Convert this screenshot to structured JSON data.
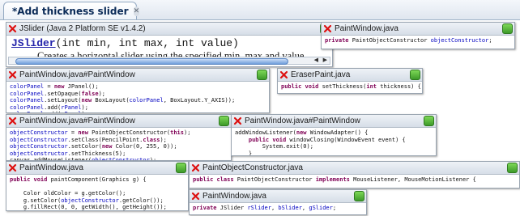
{
  "tab": {
    "label": "*Add thickness slider",
    "close": "✕"
  },
  "doc": {
    "title": "JSlider (Java 2 Platform SE v1.4.2)",
    "sig_link": "JSlider",
    "sig_rest": "(int min, int max, int value)",
    "description": "Creates a horizontal slider using the specified min, max and value."
  },
  "bubbles": [
    {
      "id": "b1",
      "title": "PaintWindow.java",
      "lines": [
        [
          [
            "kw",
            "private "
          ],
          [
            "t",
            "PaintObjectConstructor "
          ],
          [
            "fld",
            "objectConstructor"
          ],
          [
            "t",
            ";"
          ]
        ]
      ]
    },
    {
      "id": "b2",
      "title": "PaintWindow.java#PaintWindow",
      "lines": [
        [
          [
            "fld",
            "colorPanel"
          ],
          [
            "t",
            " = "
          ],
          [
            "kw",
            "new"
          ],
          [
            "t",
            " JPanel();"
          ]
        ],
        [
          [
            "fld",
            "colorPanel"
          ],
          [
            "t",
            ".setOpaque("
          ],
          [
            "kw",
            "false"
          ],
          [
            "t",
            ");"
          ]
        ],
        [
          [
            "fld",
            "colorPanel"
          ],
          [
            "t",
            ".setLayout("
          ],
          [
            "kw",
            "new"
          ],
          [
            "t",
            " BoxLayout("
          ],
          [
            "fld",
            "colorPanel"
          ],
          [
            "t",
            ", BoxLayout.Y_AXIS));"
          ]
        ],
        [
          [
            "fld",
            "colorPanel"
          ],
          [
            "t",
            ".add("
          ],
          [
            "fld",
            "rPanel"
          ],
          [
            "t",
            ");"
          ]
        ],
        [
          [
            "fld",
            "colorPanel"
          ],
          [
            "t",
            ".add("
          ],
          [
            "fld",
            "gPanel"
          ],
          [
            "t",
            ");"
          ]
        ]
      ]
    },
    {
      "id": "b3",
      "title": "EraserPaint.java",
      "lines": [
        [
          [
            "kw",
            "public void"
          ],
          [
            "t",
            " setThickness("
          ],
          [
            "kw",
            "int"
          ],
          [
            "t",
            " thickness) {"
          ]
        ]
      ]
    },
    {
      "id": "b4",
      "title": "PaintWindow.java#PaintWindow",
      "lines": [
        [
          [
            "fld",
            "objectConstructor"
          ],
          [
            "t",
            " = "
          ],
          [
            "kw",
            "new"
          ],
          [
            "t",
            " PointObjectConstructor("
          ],
          [
            "kw",
            "this"
          ],
          [
            "t",
            ");"
          ]
        ],
        [
          [
            "fld",
            "objectConstructor"
          ],
          [
            "t",
            ".setClass(PencilPoint."
          ],
          [
            "kw",
            "class"
          ],
          [
            "t",
            ");"
          ]
        ],
        [
          [
            "fld",
            "objectConstructor"
          ],
          [
            "t",
            ".setColor("
          ],
          [
            "kw",
            "new"
          ],
          [
            "t",
            " Color(0, 255, 0));"
          ]
        ],
        [
          [
            "fld",
            "objectConstructor"
          ],
          [
            "t",
            ".setThickness(5);"
          ]
        ],
        [
          [
            "t",
            "canvas.addMouseListener("
          ],
          [
            "fld",
            "objectConstructor"
          ],
          [
            "t",
            ");"
          ]
        ]
      ]
    },
    {
      "id": "b5",
      "title": "PaintWindow.java#PaintWindow",
      "lines": [
        [
          [
            "t",
            "addWindowListener("
          ],
          [
            "kw",
            "new"
          ],
          [
            "t",
            " WindowAdapter() {"
          ]
        ],
        [
          [
            "t",
            "    "
          ],
          [
            "kw",
            "public void"
          ],
          [
            "t",
            " windowClosing(WindowEvent event) {"
          ]
        ],
        [
          [
            "t",
            "        System.exit(0);"
          ]
        ],
        [
          [
            "t",
            "    }"
          ]
        ]
      ]
    },
    {
      "id": "b6",
      "title": "PaintWindow.java",
      "lines": [
        [
          [
            "kw",
            "public void"
          ],
          [
            "t",
            " paintComponent(Graphics g) {"
          ]
        ],
        [
          [
            "t",
            ""
          ]
        ],
        [
          [
            "t",
            "    Color oldColor = g.getColor();"
          ]
        ],
        [
          [
            "t",
            "    g.setColor("
          ],
          [
            "fld",
            "objectConstructor"
          ],
          [
            "t",
            ".getColor());"
          ]
        ],
        [
          [
            "t",
            "    g.fillRect(0, 0, getWidth(), getHeight());"
          ]
        ]
      ]
    },
    {
      "id": "b7",
      "title": "PaintObjectConstructor.java",
      "lines": [
        [
          [
            "kw",
            "public class"
          ],
          [
            "t",
            " PaintObjectConstructor "
          ],
          [
            "kw",
            "implements"
          ],
          [
            "t",
            " MouseListener, MouseMotionListener {"
          ]
        ]
      ]
    },
    {
      "id": "b8",
      "title": "PaintWindow.java",
      "lines": [
        [
          [
            "kw",
            "private"
          ],
          [
            "t",
            " JSlider "
          ],
          [
            "fld",
            "rSlider"
          ],
          [
            "t",
            ", "
          ],
          [
            "fld",
            "bSlider"
          ],
          [
            "t",
            ", "
          ],
          [
            "fld",
            "gSlider"
          ],
          [
            "t",
            ";"
          ]
        ]
      ]
    }
  ]
}
